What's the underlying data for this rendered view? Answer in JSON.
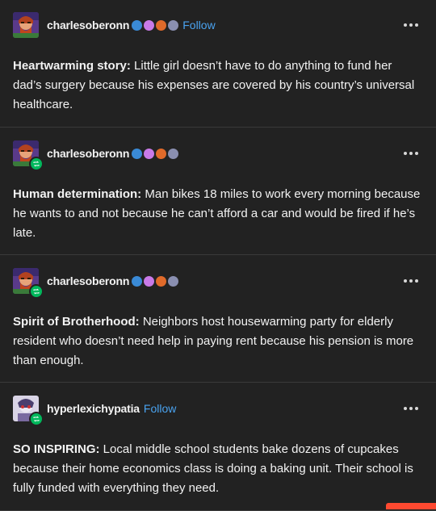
{
  "colors": {
    "background": "#222222",
    "text": "#f2f2f2",
    "link": "#4aa3f0",
    "reblog": "#00b85c",
    "divider": "#3a3a3a"
  },
  "posts": [
    {
      "username": "charlesoberonn",
      "follow_label": "Follow",
      "lead": "Heartwarming story:",
      "text": " Little girl doesn’t have to do anything to fund her dad’s surgery because his expenses are covered by his country’s universal healthcare."
    },
    {
      "username": "charlesoberonn",
      "lead": "Human determination:",
      "text": " Man bikes 18 miles to work every morning because he wants to and not because he can’t afford a car and would be fired if he’s late."
    },
    {
      "username": "charlesoberonn",
      "lead": "Spirit of Brotherhood:",
      "text": " Neighbors host housewarming party for elderly resident who doesn’t need help in paying rent because his pension is more than enough."
    },
    {
      "username": "hyperlexichypatia",
      "follow_label": "Follow",
      "lead": "SO INSPIRING:",
      "text": " Local middle school students bake dozens of cupcakes because their home economics class is doing a baking unit. Their school is fully funded with everything they need."
    }
  ],
  "icons": {
    "more": "more-options-icon",
    "reblog": "reblog-icon",
    "badges": [
      "character-badge-icon",
      "sparkle-badge-icon",
      "paw-badge-icon",
      "ghost-badge-icon"
    ]
  }
}
